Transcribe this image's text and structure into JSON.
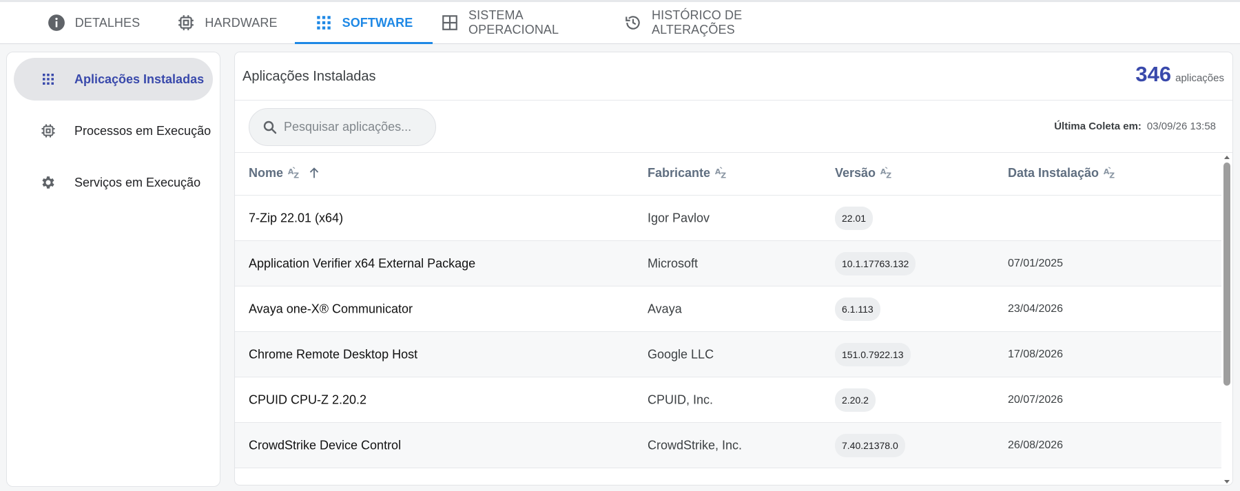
{
  "tabs": [
    {
      "label": "DETALHES",
      "icon": "info-icon",
      "active": false
    },
    {
      "label": "HARDWARE",
      "icon": "chip-icon",
      "active": false
    },
    {
      "label": "SOFTWARE",
      "icon": "apps-grid-icon",
      "active": true
    },
    {
      "label": "SISTEMA OPERACIONAL",
      "icon": "window-grid-icon",
      "active": false
    },
    {
      "label": "HISTÓRICO DE ALTERAÇÕES",
      "icon": "history-icon",
      "active": false
    }
  ],
  "sidebar": {
    "items": [
      {
        "label": "Aplicações Instaladas",
        "icon": "apps-grid-icon",
        "active": true
      },
      {
        "label": "Processos em Execução",
        "icon": "chip-icon",
        "active": false
      },
      {
        "label": "Serviços em Execução",
        "icon": "gear-icon",
        "active": false
      }
    ]
  },
  "main": {
    "title": "Aplicações Instaladas",
    "count": "346",
    "count_label": "aplicações",
    "search_placeholder": "Pesquisar aplicações...",
    "last_collect_label": "Última Coleta em:",
    "last_collect_value": "03/09/26 13:58"
  },
  "table": {
    "columns": [
      "Nome",
      "Fabricante",
      "Versão",
      "Data Instalação"
    ],
    "rows": [
      {
        "nome": "7-Zip 22.01 (x64)",
        "fabricante": "Igor Pavlov",
        "versao": "22.01",
        "data": ""
      },
      {
        "nome": "Application Verifier x64 External Package",
        "fabricante": "Microsoft",
        "versao": "10.1.17763.132",
        "data": "07/01/2025"
      },
      {
        "nome": "Avaya one-X® Communicator",
        "fabricante": "Avaya",
        "versao": "6.1.113",
        "data": "23/04/2026"
      },
      {
        "nome": "Chrome Remote Desktop Host",
        "fabricante": "Google LLC",
        "versao": "151.0.7922.13",
        "data": "17/08/2026"
      },
      {
        "nome": "CPUID CPU-Z 2.20.2",
        "fabricante": "CPUID, Inc.",
        "versao": "2.20.2",
        "data": "20/07/2026"
      },
      {
        "nome": "CrowdStrike Device Control",
        "fabricante": "CrowdStrike, Inc.",
        "versao": "7.40.21378.0",
        "data": "26/08/2026"
      }
    ]
  },
  "colors": {
    "accent_tab": "#1e88e5",
    "accent_primary": "#3949ab",
    "header_text": "#5f6e80"
  }
}
